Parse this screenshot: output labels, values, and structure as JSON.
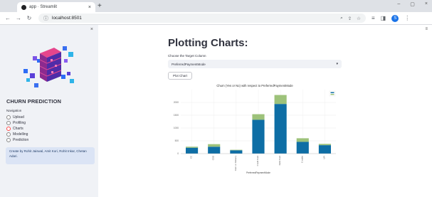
{
  "browser": {
    "tab_title": "app · Streamlit",
    "tab_close": "×",
    "new_tab": "+",
    "url": "localhost:8501",
    "profile_initial": "S",
    "window_controls": [
      "–",
      "▢",
      "×"
    ]
  },
  "sidebar": {
    "close": "×",
    "app_title": "CHURN PREDICTION",
    "nav_label": "Navigation",
    "items": [
      {
        "label": "Upload",
        "selected": false
      },
      {
        "label": "Profiling",
        "selected": false
      },
      {
        "label": "Charts",
        "selected": true
      },
      {
        "label": "Modelling",
        "selected": false
      },
      {
        "label": "Prediction",
        "selected": false
      }
    ],
    "credits": "Create by Rohit Jaiswal, Amit Kori, Rohit Inkar, Chetan Adari."
  },
  "main": {
    "menu_icon": "≡",
    "title": "Plotting Charts:",
    "select_label": "Choose the Target Column",
    "select_value": "PreferredPaymentMode",
    "plot_button": "Plot Chart"
  },
  "chart_data": {
    "type": "bar",
    "stacked": true,
    "title": "Churn (Yes or No) with respect to PreferredPaymentMode",
    "xlabel": "PreferredPaymentMode",
    "ylabel": "",
    "categories": [
      "CC",
      "COD",
      "Cash on Delivery",
      "Credit Card",
      "Debit Card",
      "E wallet",
      "UPI"
    ],
    "ylim": [
      0,
      2500
    ],
    "yticks": [
      0,
      500,
      1000,
      1500,
      2000
    ],
    "grid": true,
    "legend": "top-right",
    "series": [
      {
        "values": [
          230,
          270,
          130,
          1320,
          1940,
          460,
          330
        ],
        "color": "#0e6ea5"
      },
      {
        "values": [
          40,
          100,
          20,
          220,
          350,
          140,
          50
        ],
        "color": "#9dc27a"
      }
    ]
  }
}
